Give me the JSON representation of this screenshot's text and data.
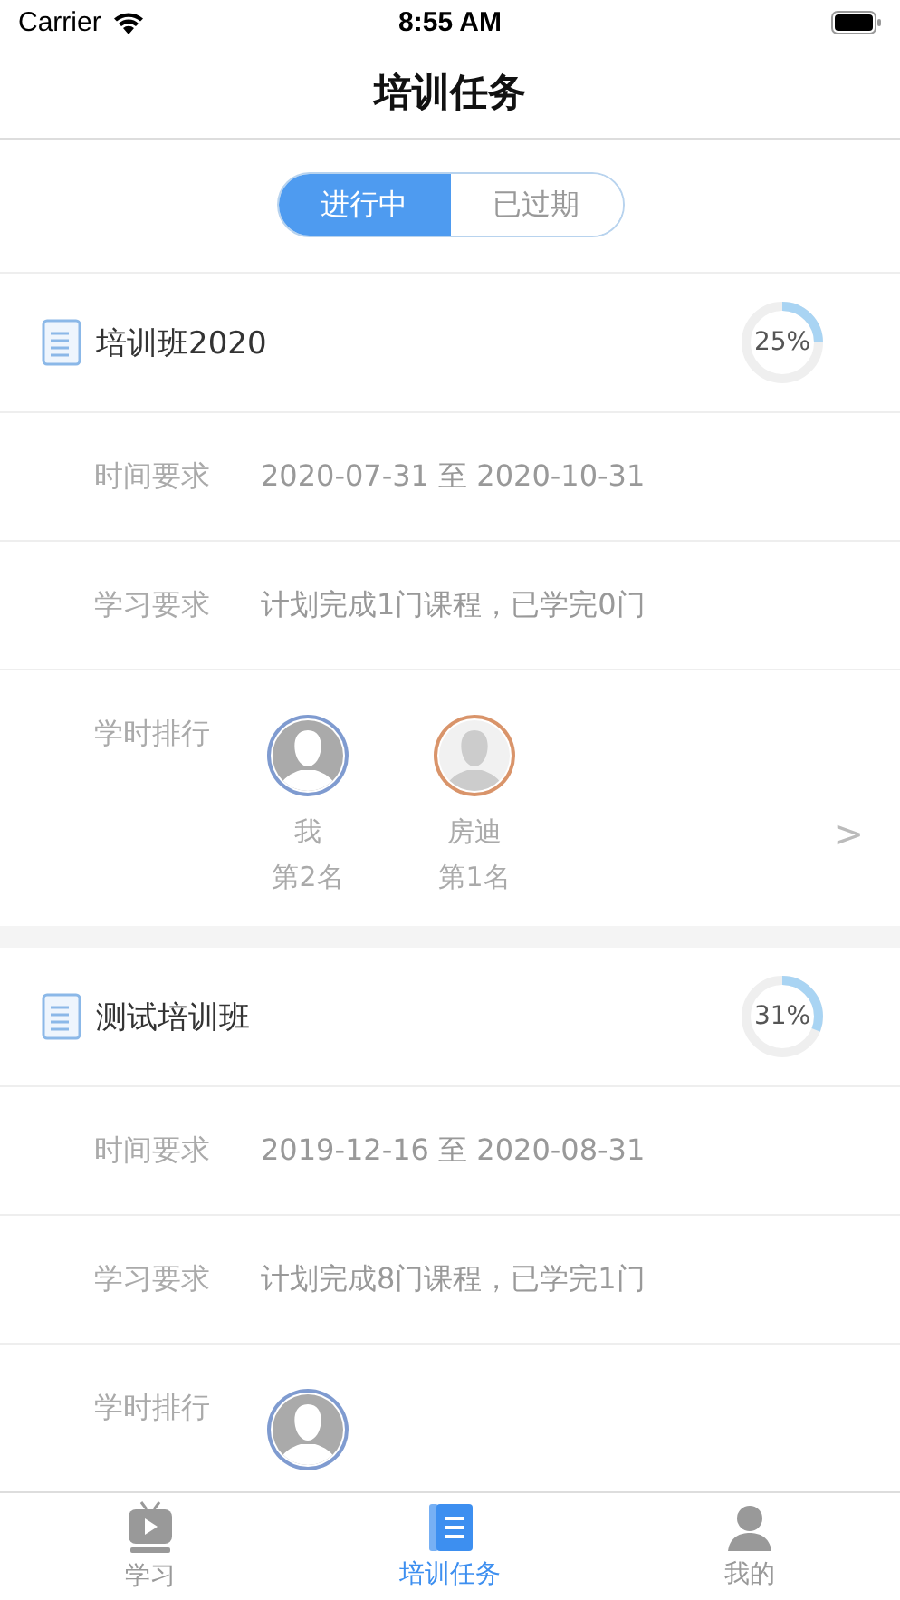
{
  "status_bar": {
    "carrier": "Carrier",
    "time": "8:55 AM"
  },
  "nav": {
    "title": "培训任务"
  },
  "segments": [
    {
      "label": "进行中",
      "selected": true
    },
    {
      "label": "已过期",
      "selected": false
    }
  ],
  "tasks": [
    {
      "title": "培训班2020",
      "progress": {
        "level": 0.25,
        "label": "25%"
      },
      "rows": [
        {
          "label": "时间要求",
          "value": "2020-07-31 至 2020-10-31"
        },
        {
          "label": "学习要求",
          "value": "计划完成1门课程，已学完0门"
        }
      ],
      "ranking": {
        "label": "学时排行",
        "more": ">",
        "people": [
          {
            "kind": "dark",
            "color": "#7f9bd0",
            "name": "我",
            "rank": "第2名"
          },
          {
            "kind": "light",
            "color": "#d9946a",
            "name": "房迪",
            "rank": "第1名"
          }
        ]
      }
    },
    {
      "title": "测试培训班",
      "progress": {
        "level": 0.31,
        "label": "31%"
      },
      "rows": [
        {
          "label": "时间要求",
          "value": "2019-12-16 至 2020-08-31"
        },
        {
          "label": "学习要求",
          "value": "计划完成8门课程，已学完1门"
        }
      ],
      "ranking": {
        "label": "学时排行",
        "people": [
          {
            "kind": "dark",
            "color": "#7f9bd0"
          }
        ]
      }
    }
  ],
  "tab_bar": [
    {
      "label": "学习",
      "kind": "tv",
      "selected": false
    },
    {
      "label": "培训任务",
      "kind": "book",
      "selected": true
    },
    {
      "label": "我的",
      "kind": "person",
      "selected": false
    }
  ]
}
